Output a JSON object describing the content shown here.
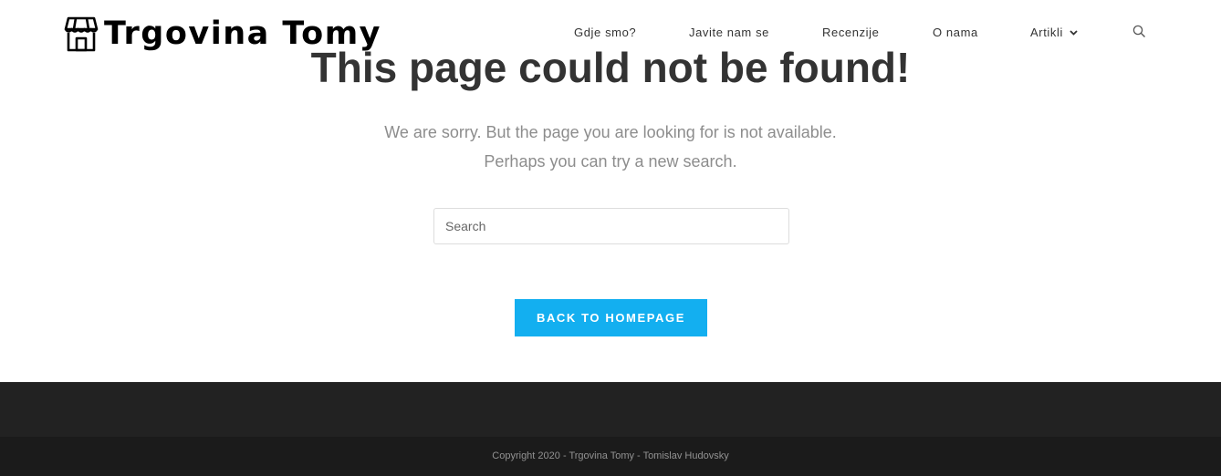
{
  "header": {
    "logo_text": "Trgovina Tomy",
    "nav": [
      {
        "label": "Gdje smo?"
      },
      {
        "label": "Javite nam se"
      },
      {
        "label": "Recenzije"
      },
      {
        "label": "O nama"
      },
      {
        "label": "Artikli",
        "has_dropdown": true
      }
    ],
    "search_icon": "search-icon"
  },
  "main": {
    "title": "This page could not be found!",
    "message_line1": "We are sorry. But the page you are looking for is not available.",
    "message_line2": "Perhaps you can try a new search.",
    "search": {
      "placeholder": "Search",
      "value": ""
    },
    "back_button_label": "BACK TO HOMEPAGE"
  },
  "footer": {
    "copyright": "Copyright 2020 - Trgovina Tomy - Tomislav Hudovsky"
  },
  "colors": {
    "accent": "#13aff0",
    "footer_dark": "#222222",
    "footer_darker": "#1b1b1b",
    "title": "#333333",
    "body_text": "#8d8d8d"
  }
}
